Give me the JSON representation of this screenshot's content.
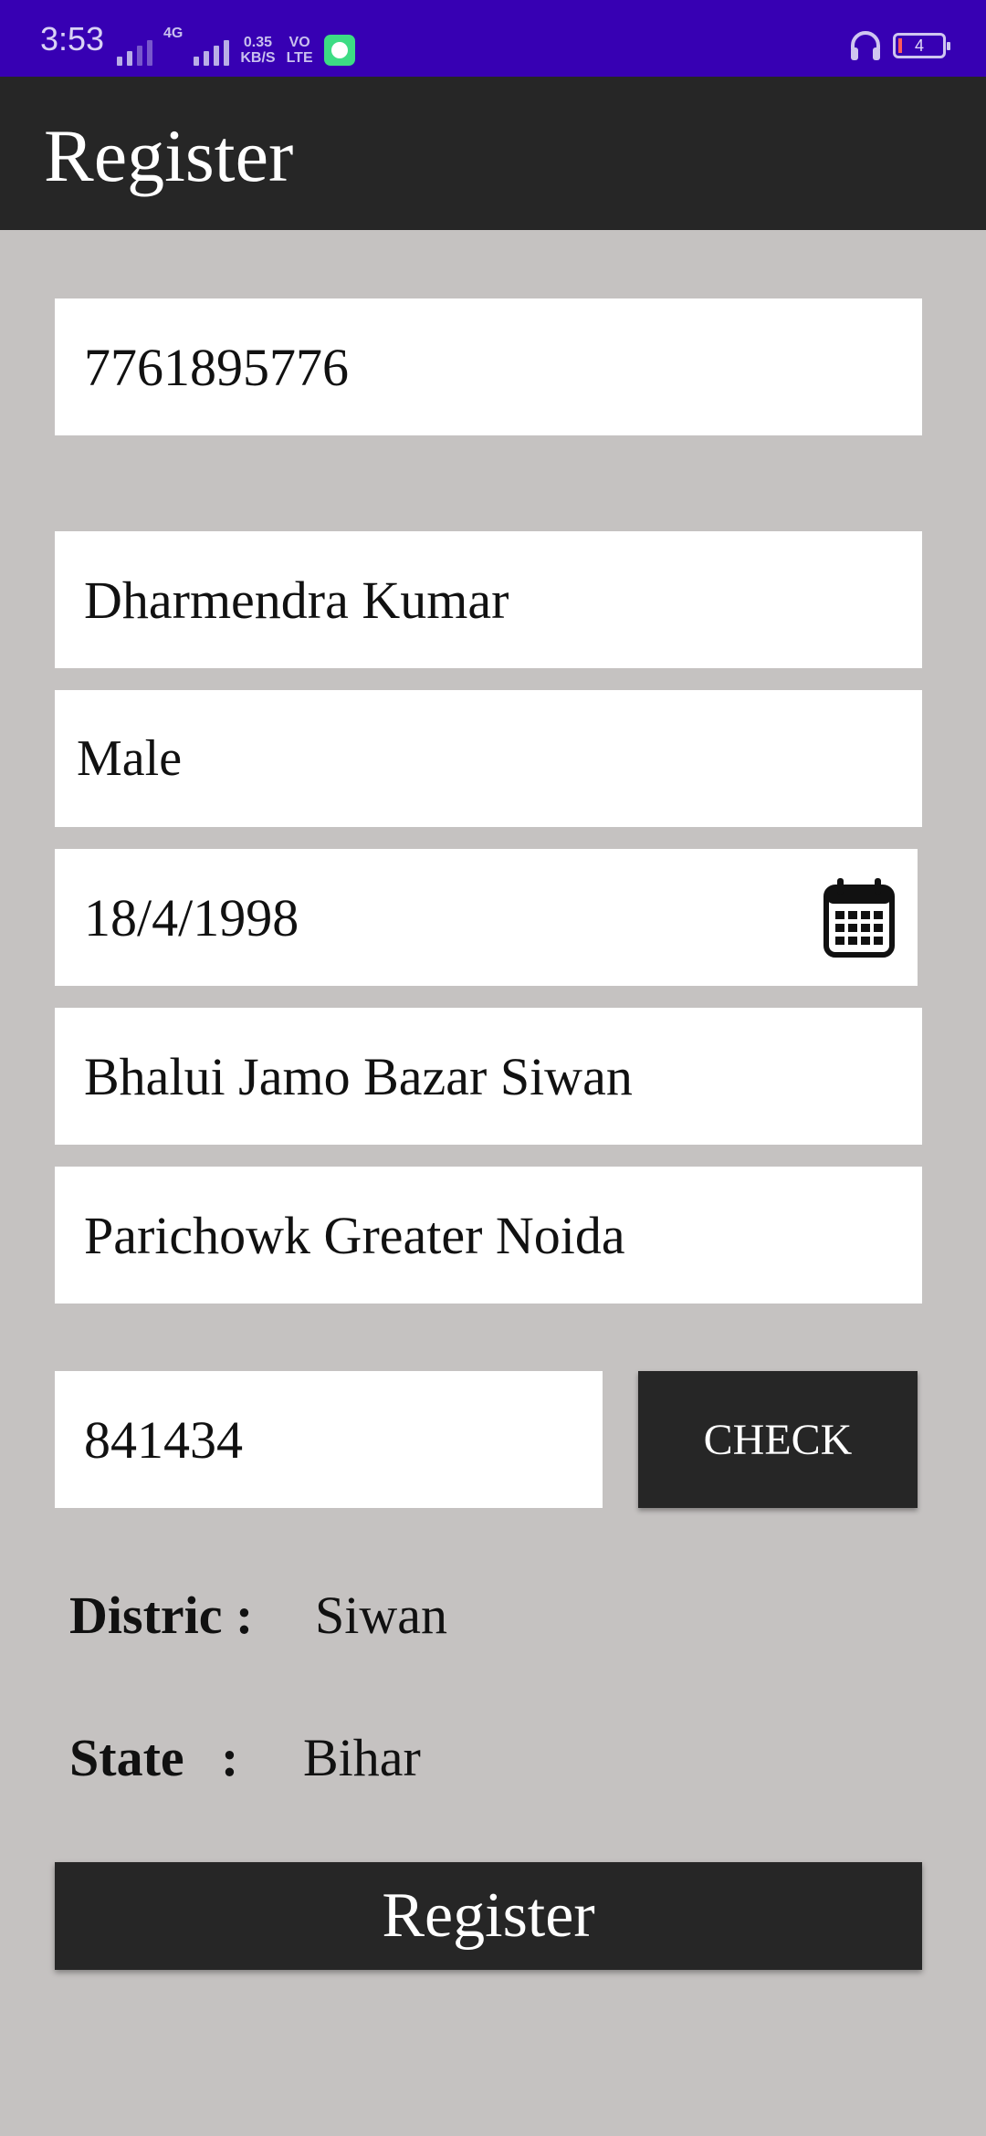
{
  "status_bar": {
    "time": "3:53",
    "net_type": "4G",
    "speed_value": "0.35",
    "speed_unit": "KB/S",
    "volte_top": "VO",
    "volte_bottom": "LTE",
    "battery_level": "4"
  },
  "appbar": {
    "title": "Register"
  },
  "form": {
    "mobile": "7761895776",
    "name": "Dharmendra Kumar",
    "gender": "Male",
    "dob": "18/4/1998",
    "address": "Bhalui Jamo Bazar Siwan",
    "current_address": "Parichowk Greater Noida",
    "pincode": "841434",
    "check_label": "CHECK"
  },
  "location": {
    "district_label": "Distric :",
    "district_value": "Siwan",
    "state_label": "State",
    "state_colon": ":",
    "state_value": "Bihar"
  },
  "submit": {
    "label": "Register"
  },
  "icons": {
    "calendar": "calendar-icon",
    "headset": "headset-icon",
    "app": "app-notification-icon"
  },
  "colors": {
    "status_bar": "#3700b3",
    "app_bar": "#262626",
    "background": "#c5c2c1",
    "button": "#262626"
  }
}
